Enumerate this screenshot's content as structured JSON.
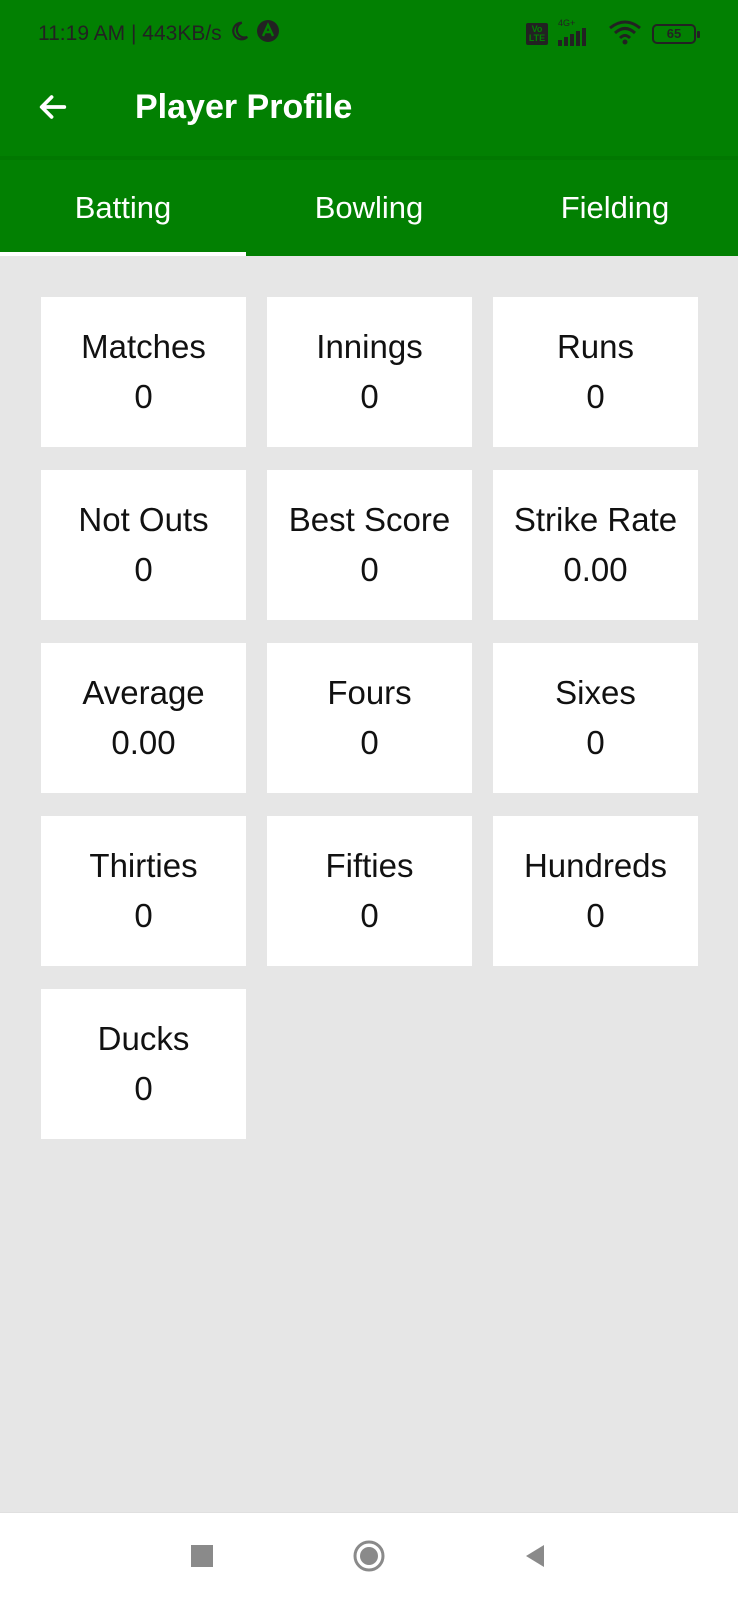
{
  "status_bar": {
    "time_and_speed": "11:19 AM | 443KB/s",
    "network_type": "4G+",
    "volte_label": "VoLTE",
    "battery_level": "65"
  },
  "toolbar": {
    "title": "Player Profile"
  },
  "tabs": [
    {
      "label": "Batting",
      "active": true
    },
    {
      "label": "Bowling",
      "active": false
    },
    {
      "label": "Fielding",
      "active": false
    }
  ],
  "stats": [
    {
      "label": "Matches",
      "value": "0"
    },
    {
      "label": "Innings",
      "value": "0"
    },
    {
      "label": "Runs",
      "value": "0"
    },
    {
      "label": "Not Outs",
      "value": "0"
    },
    {
      "label": "Best Score",
      "value": "0"
    },
    {
      "label": "Strike Rate",
      "value": "0.00"
    },
    {
      "label": "Average",
      "value": "0.00"
    },
    {
      "label": "Fours",
      "value": "0"
    },
    {
      "label": "Sixes",
      "value": "0"
    },
    {
      "label": "Thirties",
      "value": "0"
    },
    {
      "label": "Fifties",
      "value": "0"
    },
    {
      "label": "Hundreds",
      "value": "0"
    },
    {
      "label": "Ducks",
      "value": "0"
    }
  ],
  "colors": {
    "primary": "#028002",
    "background": "#e6e6e6",
    "card": "#ffffff"
  },
  "icons": {
    "back": "arrow-left-icon",
    "recents": "square-icon",
    "home": "circle-icon",
    "nav_back": "triangle-left-icon"
  }
}
